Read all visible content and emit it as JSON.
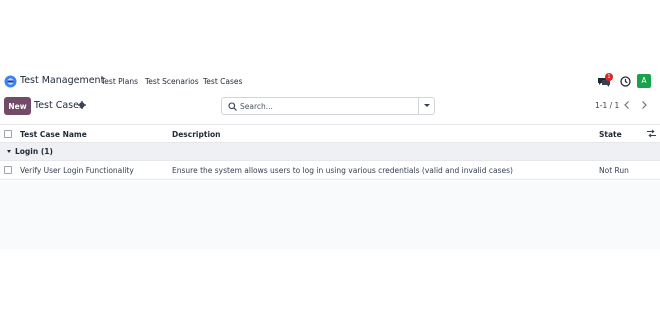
{
  "topbar": {
    "app_title": "Test Management",
    "nav": [
      "Test Plans",
      "Test Scenarios",
      "Test Cases"
    ],
    "notification_count": "1",
    "avatar_letter": "A",
    "colors": {
      "avatar": "#16a34a",
      "badge": "#dc2626"
    }
  },
  "controlbar": {
    "new_label": "New",
    "breadcrumb": "Test Cases",
    "search_placeholder": "Search...",
    "pager": "1-1 / 1",
    "colors": {
      "primary": "#714b67"
    }
  },
  "table": {
    "columns": [
      "Test Case Name",
      "Description",
      "State"
    ],
    "group": {
      "label": "Login (1)"
    },
    "rows": [
      {
        "name": "Verify User Login Functionality",
        "description": "Ensure the system allows users to log in using various credentials (valid and invalid cases)",
        "state": "Not Run"
      }
    ]
  }
}
